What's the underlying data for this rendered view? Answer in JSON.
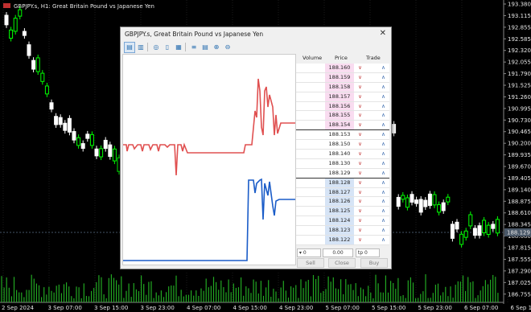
{
  "chart": {
    "title": "GBPJPY.s, H1:  Great Britain Pound vs Japanese Yen",
    "price_axis": [
      "193.380",
      "193.115",
      "192.855",
      "192.585",
      "192.320",
      "192.055",
      "191.790",
      "191.525",
      "191.260",
      "190.995",
      "190.730",
      "190.465",
      "190.200",
      "189.935",
      "189.670",
      "189.405",
      "189.140",
      "188.875",
      "188.610",
      "188.345",
      "188.080",
      "187.815",
      "187.555",
      "187.290",
      "187.025",
      "186.755"
    ],
    "current_price": "188.129",
    "time_axis": [
      "2 Sep 2024",
      "3 Sep 07:00",
      "3 Sep 15:00",
      "3 Sep 23:00",
      "4 Sep 07:00",
      "4 Sep 15:00",
      "4 Sep 23:00",
      "5 Sep 07:00",
      "5 Sep 15:00",
      "5 Sep 23:00",
      "6 Sep 07:00",
      "6 Sep 15:00"
    ],
    "colors": {
      "bg": "#000000",
      "bull": "#00ff00",
      "bear": "#ffffff",
      "volume": "#22a822",
      "text": "#e6e6e6"
    }
  },
  "dom": {
    "title": "GBPJPY.s, Great Britain Pound vs Japanese Yen",
    "close_label": "✕",
    "headers": {
      "volume": "Volume",
      "price": "Price",
      "trade": "Trade"
    },
    "ask_prices": [
      "188.160",
      "188.159",
      "188.158",
      "188.157",
      "188.156",
      "188.155",
      "188.154"
    ],
    "mid_prices": [
      "188.153",
      "188.150",
      "188.140",
      "188.130",
      "188.129"
    ],
    "bid_prices": [
      "188.128",
      "188.127",
      "188.126",
      "188.125",
      "188.124",
      "188.123",
      "188.122"
    ],
    "volume_value": "0",
    "price_value": "0.00",
    "tp_value": "0",
    "buttons": {
      "sell": "Sell",
      "close": "Close",
      "buy": "Buy"
    },
    "toolbar_icons": [
      "chart-icon",
      "ladder-icon",
      "hide-icon",
      "columns-icon",
      "filter-icon",
      "bars-icon",
      "levels-icon",
      "zoom-in-icon",
      "zoom-out-icon"
    ],
    "colors": {
      "ask": "#f9dcf0",
      "bid": "#d6e4f6",
      "ask_line": "#e05050",
      "bid_line": "#1a5cc8"
    }
  }
}
